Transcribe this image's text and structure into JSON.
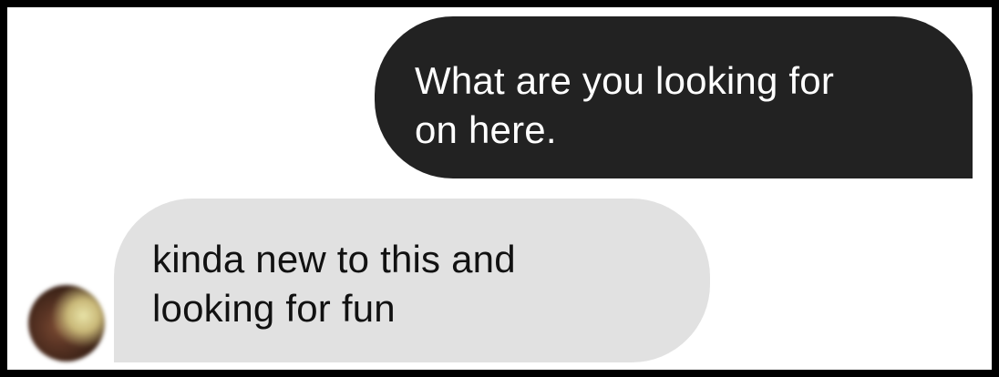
{
  "conversation": {
    "messages": [
      {
        "direction": "sent",
        "lines": [
          "What are you looking for",
          "on here."
        ]
      },
      {
        "direction": "received",
        "lines": [
          "kinda new to this and",
          "looking for fun"
        ]
      }
    ],
    "avatar_icon": "contact-avatar-photo",
    "colors": {
      "sent_bubble": "#222222",
      "sent_text": "#ffffff",
      "received_bubble": "#e1e1e1",
      "received_text": "#111111"
    }
  }
}
